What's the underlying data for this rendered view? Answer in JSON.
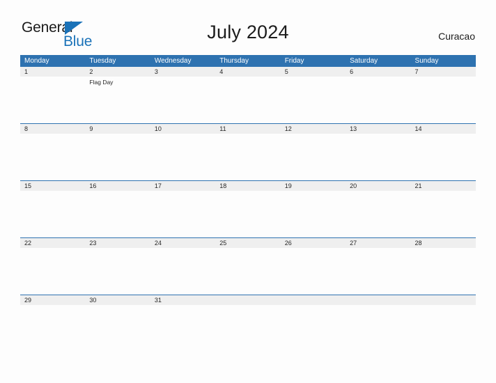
{
  "branding": {
    "logo_primary": "General",
    "logo_secondary": "Blue",
    "logo_mark": "triangle-flag-icon",
    "primary_color": "#2e72b0",
    "band_color": "#efefef"
  },
  "header": {
    "title": "July 2024",
    "region": "Curacao"
  },
  "calendar": {
    "weekdays": [
      "Monday",
      "Tuesday",
      "Wednesday",
      "Thursday",
      "Friday",
      "Saturday",
      "Sunday"
    ],
    "weeks": [
      {
        "days": [
          {
            "date": "1",
            "events": []
          },
          {
            "date": "2",
            "events": [
              "Flag Day"
            ]
          },
          {
            "date": "3",
            "events": []
          },
          {
            "date": "4",
            "events": []
          },
          {
            "date": "5",
            "events": []
          },
          {
            "date": "6",
            "events": []
          },
          {
            "date": "7",
            "events": []
          }
        ]
      },
      {
        "days": [
          {
            "date": "8",
            "events": []
          },
          {
            "date": "9",
            "events": []
          },
          {
            "date": "10",
            "events": []
          },
          {
            "date": "11",
            "events": []
          },
          {
            "date": "12",
            "events": []
          },
          {
            "date": "13",
            "events": []
          },
          {
            "date": "14",
            "events": []
          }
        ]
      },
      {
        "days": [
          {
            "date": "15",
            "events": []
          },
          {
            "date": "16",
            "events": []
          },
          {
            "date": "17",
            "events": []
          },
          {
            "date": "18",
            "events": []
          },
          {
            "date": "19",
            "events": []
          },
          {
            "date": "20",
            "events": []
          },
          {
            "date": "21",
            "events": []
          }
        ]
      },
      {
        "days": [
          {
            "date": "22",
            "events": []
          },
          {
            "date": "23",
            "events": []
          },
          {
            "date": "24",
            "events": []
          },
          {
            "date": "25",
            "events": []
          },
          {
            "date": "26",
            "events": []
          },
          {
            "date": "27",
            "events": []
          },
          {
            "date": "28",
            "events": []
          }
        ]
      },
      {
        "days": [
          {
            "date": "29",
            "events": []
          },
          {
            "date": "30",
            "events": []
          },
          {
            "date": "31",
            "events": []
          },
          {
            "date": "",
            "events": []
          },
          {
            "date": "",
            "events": []
          },
          {
            "date": "",
            "events": []
          },
          {
            "date": "",
            "events": []
          }
        ]
      }
    ]
  }
}
